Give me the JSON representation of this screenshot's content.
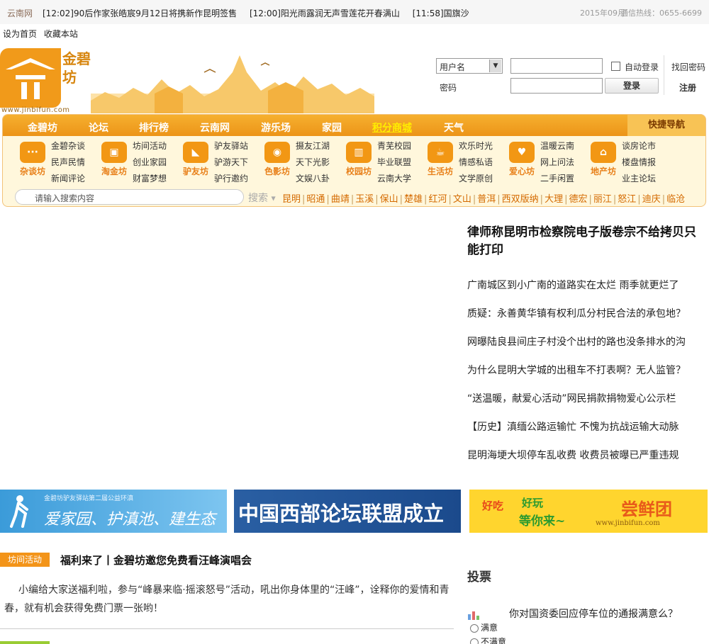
{
  "ticker": {
    "source": "云南网",
    "items": [
      "[12:02]90后作家张皓宸9月12日将携新作昆明签售",
      "[12:00]阳光雨露润无声雪莲花开春满山",
      "[11:58]国旗沙"
    ],
    "date": "2015年09月",
    "hotline": "通信热线：0655-6699"
  },
  "toplinks": [
    "设为首页",
    "收藏本站"
  ],
  "logo": {
    "text": "金碧坊",
    "url": "www.jinbifun.com"
  },
  "login": {
    "type_select": "用户名",
    "password_label": "密码",
    "auto_login": "自动登录",
    "find_password": "找回密码",
    "login_button": "登录",
    "register": "注册"
  },
  "nav": {
    "items": [
      "金碧坊",
      "论坛",
      "排行榜",
      "云南网",
      "游乐场",
      "家园",
      "积分商城",
      "天气"
    ],
    "highlight": "积分商城",
    "quick_nav": "快捷导航"
  },
  "categories": [
    {
      "name": "杂谈坊",
      "links": [
        "金碧杂谈",
        "民声民情",
        "新闻评论"
      ]
    },
    {
      "name": "淘金坊",
      "links": [
        "坊间活动",
        "创业家园",
        "财富梦想"
      ]
    },
    {
      "name": "驴友坊",
      "links": [
        "驴友驿站",
        "驴游天下",
        "驴行邀约"
      ]
    },
    {
      "name": "色影坊",
      "links": [
        "摄友江湖",
        "天下光影",
        "文娱八卦"
      ]
    },
    {
      "name": "校园坊",
      "links": [
        "青芜校园",
        "毕业联盟",
        "云南大学"
      ]
    },
    {
      "name": "生活坊",
      "links": [
        "欢乐时光",
        "情感私语",
        "文学原创"
      ]
    },
    {
      "name": "爱心坊",
      "links": [
        "温暖云南",
        "网上问法",
        "二手闲置"
      ]
    },
    {
      "name": "地产坊",
      "links": [
        "谈房论市",
        "楼盘情报",
        "业主论坛"
      ]
    }
  ],
  "search": {
    "placeholder": "请输入搜索内容",
    "button": "搜索",
    "cities": [
      "昆明",
      "昭通",
      "曲靖",
      "玉溪",
      "保山",
      "楚雄",
      "红河",
      "文山",
      "普洱",
      "西双版纳",
      "大理",
      "德宏",
      "丽江",
      "怒江",
      "迪庆",
      "临沧"
    ]
  },
  "headline": "律师称昆明市检察院电子版卷宗不给拷贝只能打印",
  "right_list": [
    "广南城区到小广南的道路实在太烂 雨季就更烂了",
    "质疑：永善黄华镇有权利瓜分村民合法的承包地？",
    "网曝陆良县间庄子村没个出村的路也没条排水的沟",
    "为什么昆明大学城的出租车不打表啊？无人监管？",
    "“送温暖，献爱心活动”网民捐款捐物爱心公示栏",
    "【历史】滇缅公路运输忙 不愧为抗战运输大动脉",
    "昆明海埂大坝停车乱收费 收费员被曝已严重违规"
  ],
  "banners": {
    "b1_small": "金碧坊驴友驿站第二届公益环滇",
    "b1_main": "爱家园、护滇池、建生态",
    "b2_main": "中国西部论坛联盟成立",
    "b3_left1": "好吃",
    "b3_left2": "好玩",
    "b3_left3": "等你来~",
    "b3_right": "尝鲜团",
    "b3_url": "www.jinbifun.com"
  },
  "article": {
    "tag": "坊间活动",
    "title": "福利来了丨金碧坊邀您免费看汪峰演唱会",
    "body": "小编给大家送福利啦，参与“峰暴来临·摇滚怒号”活动，吼出你身体里的“汪峰”，诠释你的爱情和青春，就有机会获得免费门票一张哟！"
  },
  "vote": {
    "title": "投票",
    "question": "你对国资委回应停车位的通报满意么？",
    "options": [
      "满意",
      "不满意"
    ]
  }
}
